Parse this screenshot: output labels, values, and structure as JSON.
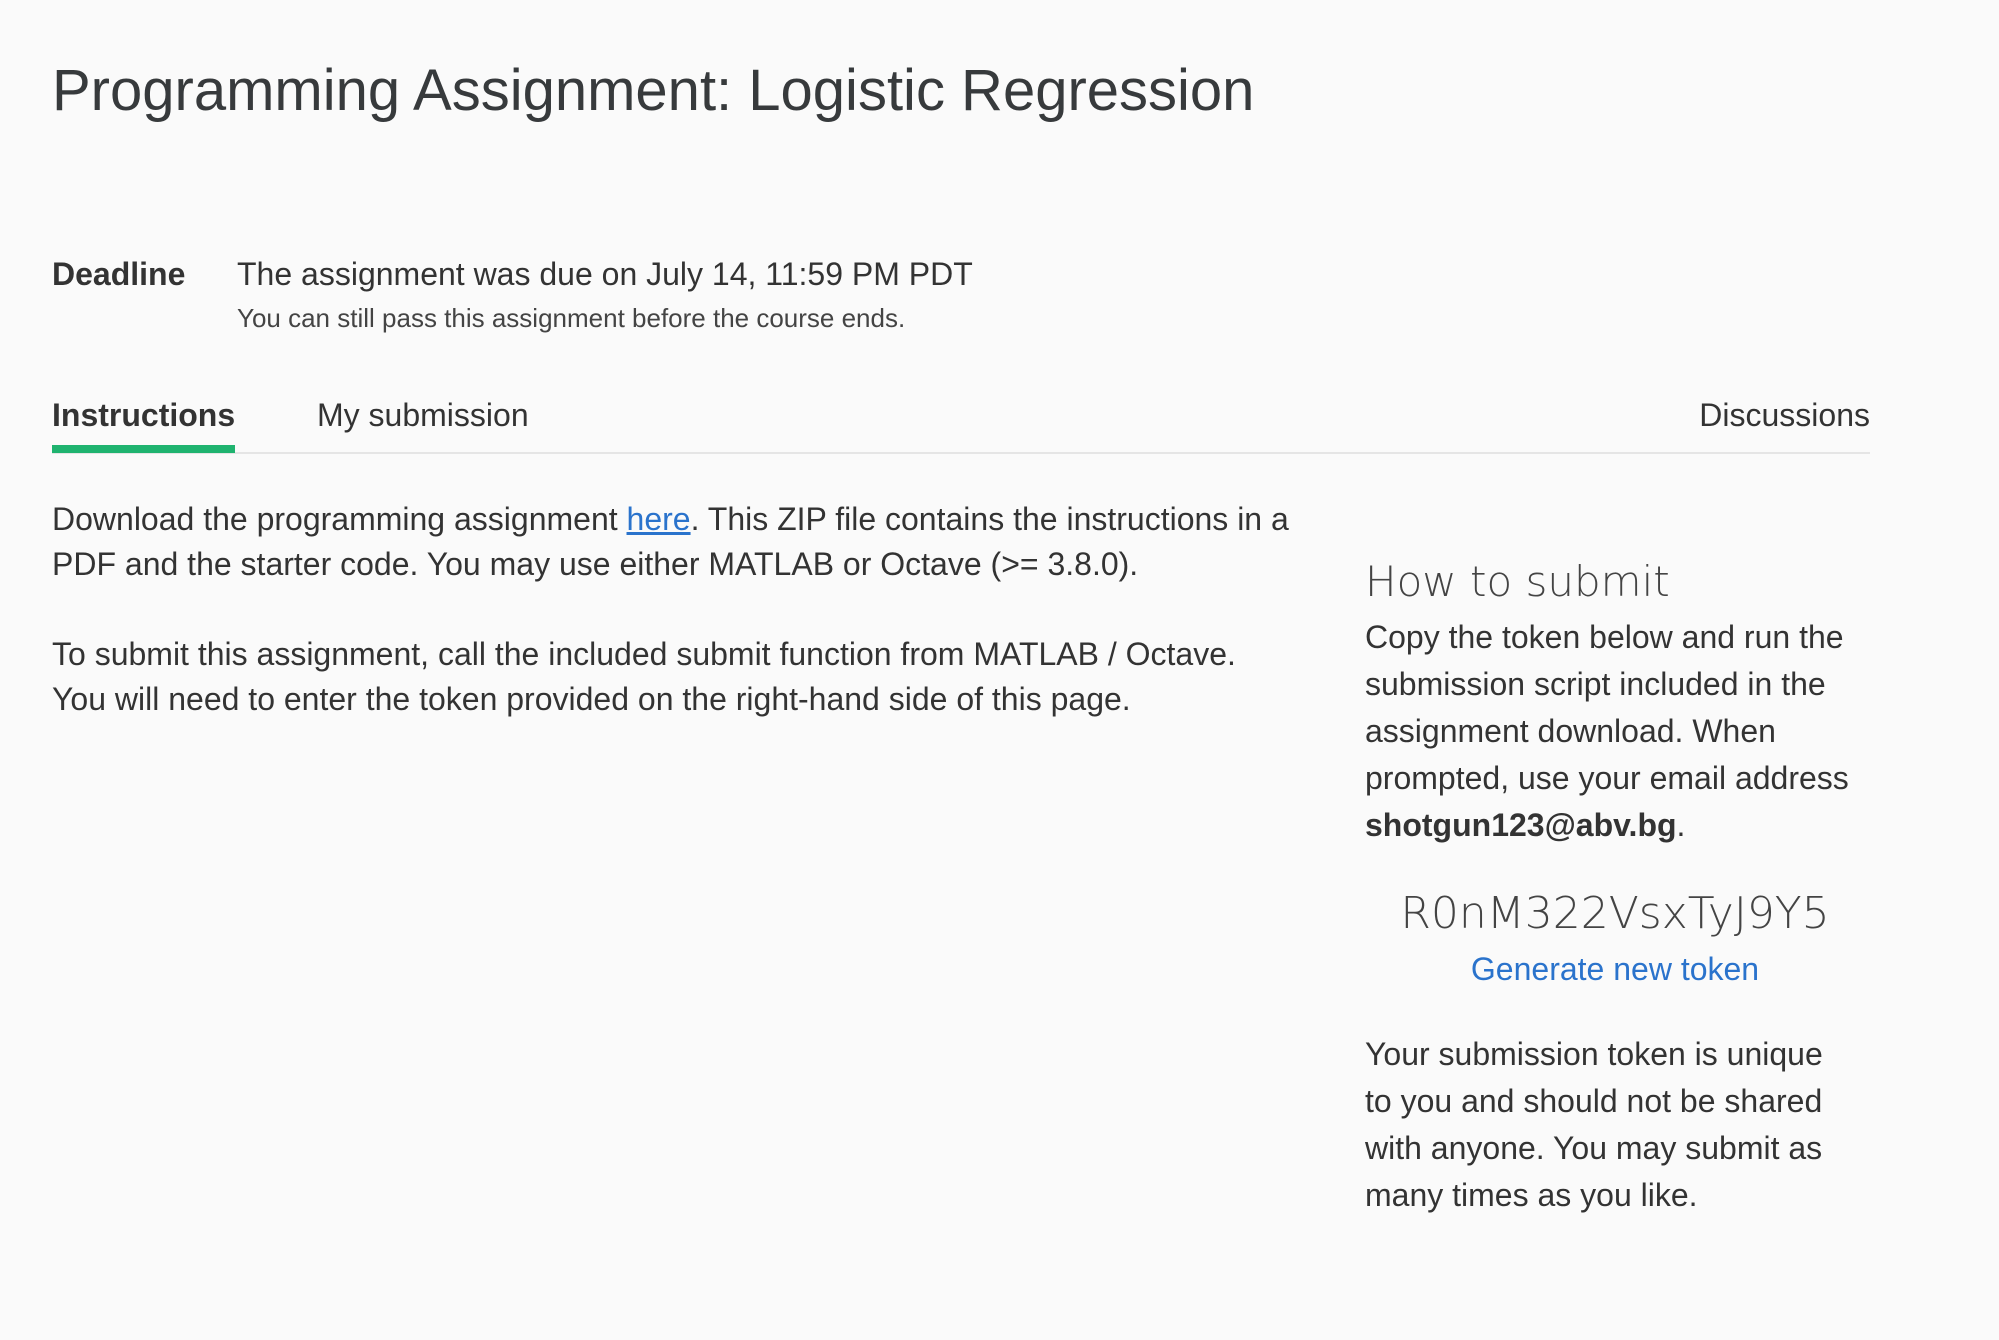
{
  "page": {
    "title": "Programming Assignment: Logistic Regression"
  },
  "deadline": {
    "label": "Deadline",
    "text": "The assignment was due on July 14, 11:59 PM PDT",
    "subtext": "You can still pass this assignment before the course ends."
  },
  "tabs": {
    "instructions": "Instructions",
    "my_submission": "My submission",
    "discussions": "Discussions",
    "active": "Instructions",
    "active_indicator_color": "#1fb36f"
  },
  "main": {
    "para1_before_link": "Download the programming assignment ",
    "para1_link": "here",
    "para1_after_link": ". This ZIP file contains the instructions in a PDF and the starter code. You may use either MATLAB or Octave (>= 3.8.0).",
    "para2": "To submit this assignment, call the included submit function from MATLAB / Octave. You will need to enter the token provided on the right-hand side of this page."
  },
  "sidebar": {
    "title": "How to submit",
    "instructions_text": "Copy the token below and run the submission script included in the assignment download. When prompted, use your email address ",
    "email": "shotgun123@abv.bg",
    "email_suffix": ".",
    "token": "R0nM322VsxTyJ9Y5",
    "generate_label": "Generate new token",
    "token_note": "Your submission token is unique to you and should not be shared with anyone. You may submit as many times as you like."
  },
  "colors": {
    "link": "#2a73cc",
    "background": "#fafafa",
    "text": "#333333"
  }
}
